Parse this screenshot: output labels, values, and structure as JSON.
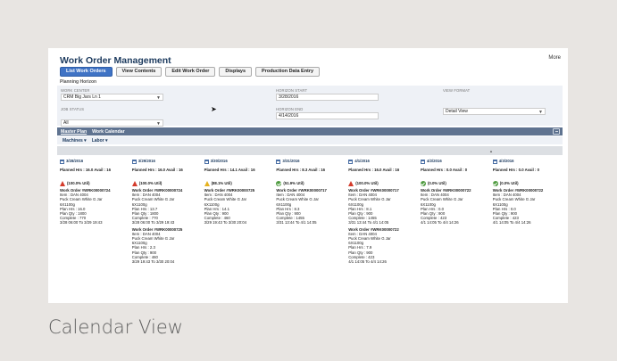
{
  "page": {
    "title": "Work Order Management",
    "more": "More",
    "caption": "Calendar View"
  },
  "toolbar": {
    "buttons": [
      "List Work Orders",
      "View Contents",
      "Edit Work Order",
      "Displays",
      "Production Data Entry"
    ]
  },
  "planning": {
    "label": "Planning Horizon",
    "work_center": {
      "label": "WORK CENTER",
      "value": "CRM Big Jars Ln 1"
    },
    "job_status": {
      "label": "JOB STATUS",
      "value": "All"
    },
    "horizon_start": {
      "label": "HORIZON START",
      "value": "3/28/2016"
    },
    "horizon_end": {
      "label": "HORIZON END",
      "value": "4/14/2016"
    },
    "view_format": {
      "label": "VIEW FORMAT",
      "value": "Detail View"
    }
  },
  "tabs": {
    "master_plan": "Master Plan",
    "work_calendar": "Work Calendar"
  },
  "subnav": {
    "machines": "Machines ▾",
    "labor": "Labor ▾"
  },
  "colors": {
    "primary_button": "#3f73c5",
    "bar": "#5f7390",
    "alert": "#d43b2b",
    "warn": "#e6b21e",
    "ok": "#4e9b3f"
  },
  "days": [
    {
      "date": "3/28/2016",
      "planned": "Planned Hrs : 16.0 Avail : 16",
      "icon": "alert",
      "util": "(100.0% Util)",
      "orders": [
        {
          "title": "Work Order #WRK00000724",
          "lines": [
            "Item : DAN 4004",
            "Puck Cream White G Jar",
            "6X1100g",
            "Plan Hrs : 16.0",
            "Plan Qty : 1800",
            "Complete : 770",
            "3/28 06:00 To 3/29 19:43"
          ]
        }
      ]
    },
    {
      "date": "3/29/2016",
      "planned": "Planned Hrs : 16.0 Avail : 16",
      "icon": "alert",
      "util": "(100.0% Util)",
      "orders": [
        {
          "title": "Work Order #WRK00000724",
          "lines": [
            "Item : DAN 4004",
            "Puck Cream White G Jar",
            "6X1100g",
            "Plan Hrs : 13.7",
            "Plan Qty : 1800",
            "Complete : 770",
            "3/28 06:00 To 3/29 19:43"
          ]
        },
        {
          "title": "Work Order #WRK00000725",
          "lines": [
            "Item : DAN 4004",
            "Puck Cream White G Jar",
            "6X1100g",
            "Plan Hrs : 2.3",
            "Plan Qty : 900",
            "Complete : 460",
            "3/29 19:43 To 3/30 20:04"
          ]
        }
      ]
    },
    {
      "date": "3/30/2016",
      "planned": "Planned Hrs : 14.1 Avail : 16",
      "icon": "warn",
      "util": "(88.1% Util)",
      "orders": [
        {
          "title": "Work Order #WRK00000725",
          "lines": [
            "Item : DAN 4004",
            "Puck Cream White G Jar",
            "6X1100g",
            "Plan Hrs : 14.1",
            "Plan Qty : 900",
            "Complete : 460",
            "3/29 19:43 To 3/30 20:04"
          ]
        }
      ]
    },
    {
      "date": "3/31/2016",
      "planned": "Planned Hrs : 8.3 Avail : 16",
      "icon": "ok",
      "util": "(51.9% Util)",
      "orders": [
        {
          "title": "Work Order #WRK00000717",
          "lines": [
            "Item : DAN 4004",
            "Puck Cream White G Jar",
            "6X1100g",
            "Plan Hrs : 8.3",
            "Plan Qty : 900",
            "Complete : 1455",
            "3/31 13:44 To 4/1 14:05"
          ]
        }
      ]
    },
    {
      "date": "4/1/2016",
      "planned": "Planned Hrs : 16.0 Avail : 16",
      "icon": "alert",
      "util": "(100.0% Util)",
      "orders": [
        {
          "title": "Work Order #WRK00000717",
          "lines": [
            "Item : DAN 4004",
            "Puck Cream White G Jar",
            "6X1100g",
            "Plan Hrs : 8.1",
            "Plan Qty : 900",
            "Complete : 1455",
            "3/31 13:44 To 4/1 14:05"
          ]
        },
        {
          "title": "Work Order #WRK00000722",
          "lines": [
            "Item : DAN 4004",
            "Puck Cream White G Jar",
            "6X1100g",
            "Plan Hrs : 7.9",
            "Plan Qty : 900",
            "Complete : 423",
            "4/1 14:05 To 4/4 14:26"
          ]
        }
      ]
    },
    {
      "date": "4/2/2016",
      "planned": "Planned Hrs : 0.0 Avail : 0",
      "icon": "ok",
      "util": "(0.0% Util)",
      "orders": [
        {
          "title": "Work Order #WRK00000722",
          "lines": [
            "Item : DAN 4004",
            "Puck Cream White G Jar",
            "6X1100g",
            "Plan Hrs : 0.0",
            "Plan Qty : 900",
            "Complete : 423",
            "4/1 14:05 To 4/4 14:26"
          ]
        }
      ]
    },
    {
      "date": "4/3/2016",
      "planned": "Planned Hrs : 0.0 Avail : 0",
      "icon": "ok",
      "util": "(0.0% Util)",
      "orders": [
        {
          "title": "Work Order #WRK00000722",
          "lines": [
            "Item : DAN 4004",
            "Puck Cream White G Jar",
            "6X1100g",
            "Plan Hrs : 0.0",
            "Plan Qty : 900",
            "Complete : 423",
            "4/1 14:05 To 4/4 14:26"
          ]
        }
      ]
    }
  ]
}
